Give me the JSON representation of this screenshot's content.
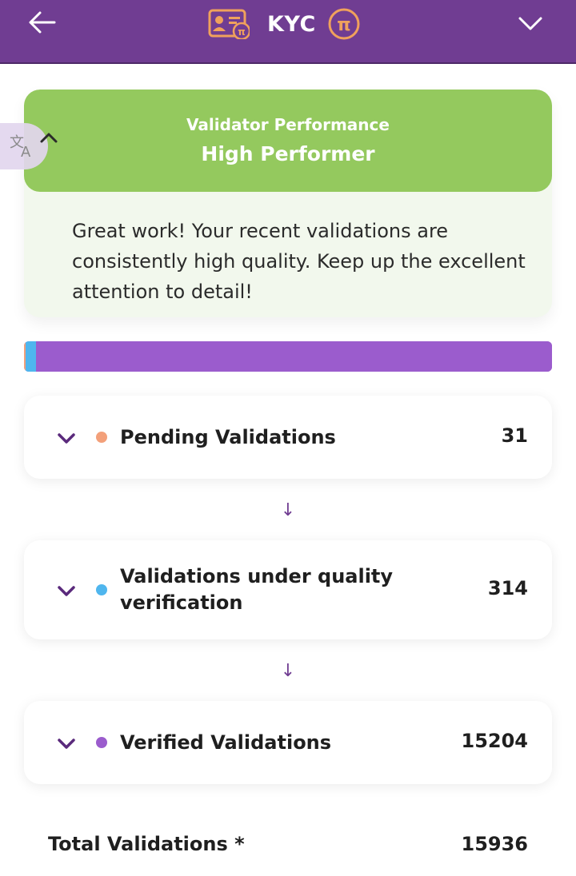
{
  "header": {
    "title": "KYC",
    "back_icon": "arrow-left-icon",
    "left_icon": "id-card-pi-icon",
    "right_icon": "pi-coin-icon",
    "menu_icon": "chevron-down-icon",
    "brand_color": "#703d92",
    "icon_color": "#f0a15c"
  },
  "performance": {
    "kicker": "Validator Performance",
    "status": "High Performer",
    "message": "Great work! Your recent validations are consistently high quality. Keep up the excellent attention to detail!",
    "accent_color": "#94c95e",
    "background_color": "#f2f8ed",
    "collapse_icon": "chevron-up-icon",
    "translate_icon": "translate-icon"
  },
  "progress": {
    "segments": [
      {
        "name": "Pending Validations",
        "value": 31,
        "color": "#f3a07a"
      },
      {
        "name": "Validations under quality verification",
        "value": 314,
        "color": "#4fb6ee"
      },
      {
        "name": "Verified Validations",
        "value": 15204,
        "color": "#9b5ccd"
      }
    ]
  },
  "validations": [
    {
      "label": "Pending Validations",
      "count": "31",
      "dot_color": "#f3a07a",
      "icon": "chevron-down-icon"
    },
    {
      "label": "Validations under quality verification",
      "count": "314",
      "dot_color": "#4fb6ee",
      "icon": "chevron-down-icon"
    },
    {
      "label": "Verified Validations",
      "count": "15204",
      "dot_color": "#9b5ccd",
      "icon": "chevron-down-icon"
    }
  ],
  "flow_arrows": [
    "↓",
    "↓"
  ],
  "total": {
    "label": "Total Validations *",
    "value": "15936"
  }
}
